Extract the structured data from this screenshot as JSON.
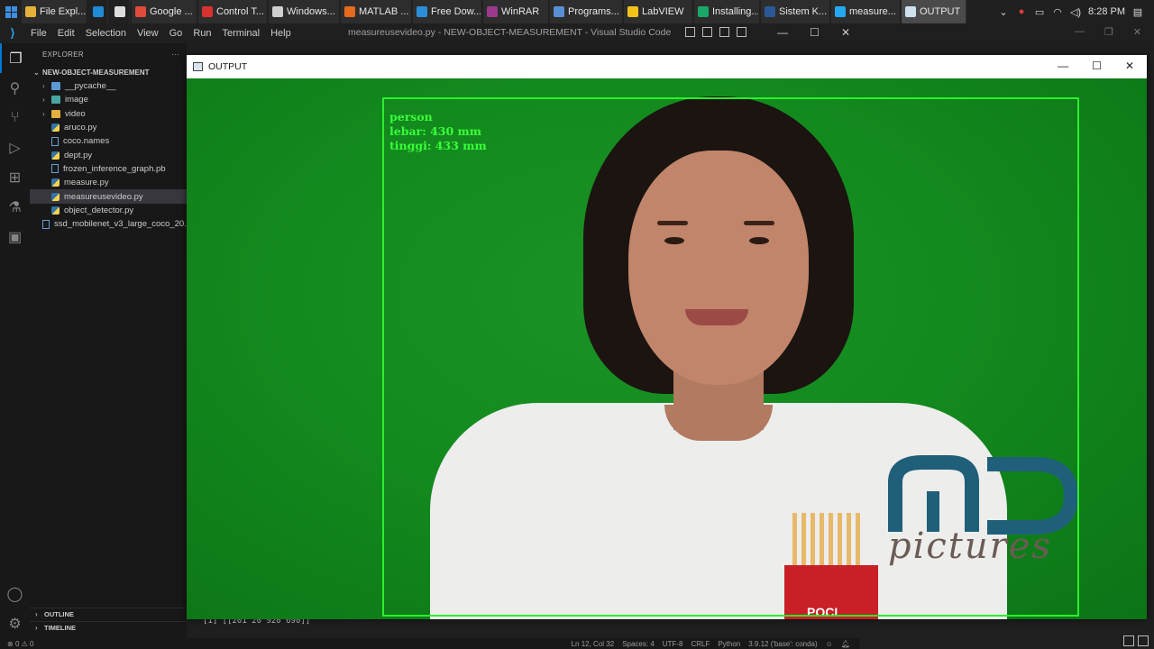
{
  "taskbar": {
    "apps": [
      {
        "label": "File Expl...",
        "color": "#e6b13b"
      },
      {
        "label": "",
        "color": "#1f8ad6"
      },
      {
        "label": "",
        "color": "#dddddd"
      },
      {
        "label": "Google ...",
        "color": "#e04b3a"
      },
      {
        "label": "Control T...",
        "color": "#d6322e"
      },
      {
        "label": "Windows...",
        "color": "#cfcfcf"
      },
      {
        "label": "MATLAB ...",
        "color": "#e46a1c"
      },
      {
        "label": "Free Dow...",
        "color": "#2a8fd8"
      },
      {
        "label": "WinRAR",
        "color": "#9b3a8c"
      },
      {
        "label": "Programs...",
        "color": "#5a8fd6"
      },
      {
        "label": "LabVIEW",
        "color": "#f2c21b"
      },
      {
        "label": "Installing...",
        "color": "#1aa868"
      },
      {
        "label": "Sistem K...",
        "color": "#2b5797"
      },
      {
        "label": "measure...",
        "color": "#23a9f2"
      },
      {
        "label": "OUTPUT",
        "color": "#cfe0f0"
      }
    ],
    "clock": "8:28 PM"
  },
  "vscode": {
    "menu": [
      "File",
      "Edit",
      "Selection",
      "View",
      "Go",
      "Run",
      "Terminal",
      "Help"
    ],
    "window_title": "measureusevideo.py - NEW-OBJECT-MEASUREMENT - Visual Studio Code",
    "explorer_label": "EXPLORER",
    "project_name": "NEW-OBJECT-MEASUREMENT",
    "tree": [
      {
        "name": "__pycache__",
        "type": "folder"
      },
      {
        "name": "image",
        "type": "folder-img"
      },
      {
        "name": "video",
        "type": "folder-vid"
      },
      {
        "name": "aruco.py",
        "type": "py"
      },
      {
        "name": "coco.names",
        "type": "txt"
      },
      {
        "name": "dept.py",
        "type": "py"
      },
      {
        "name": "frozen_inference_graph.pb",
        "type": "txt"
      },
      {
        "name": "measure.py",
        "type": "py"
      },
      {
        "name": "measureusevideo.py",
        "type": "py",
        "selected": true
      },
      {
        "name": "object_detector.py",
        "type": "py"
      },
      {
        "name": "ssd_mobilenet_v3_large_coco_20...",
        "type": "txt"
      }
    ],
    "outline_label": "OUTLINE",
    "timeline_label": "TIMELINE",
    "terminal_line": "[1] [[201  20 920 690]]",
    "status": {
      "errors": "0",
      "warnings": "0",
      "position": "Ln 12, Col 32",
      "spaces": "Spaces: 4",
      "encoding": "UTF-8",
      "eol": "CRLF",
      "language": "Python",
      "interpreter": "3.9.12 ('base': conda)"
    }
  },
  "output_window": {
    "title": "OUTPUT",
    "detection": {
      "label": "person",
      "width_text": "lebar: 430 mm",
      "height_text": "tinggi: 433 mm",
      "box_color": "#2bf02b"
    },
    "cup_text": "POCI",
    "watermark_text": "pictures"
  }
}
